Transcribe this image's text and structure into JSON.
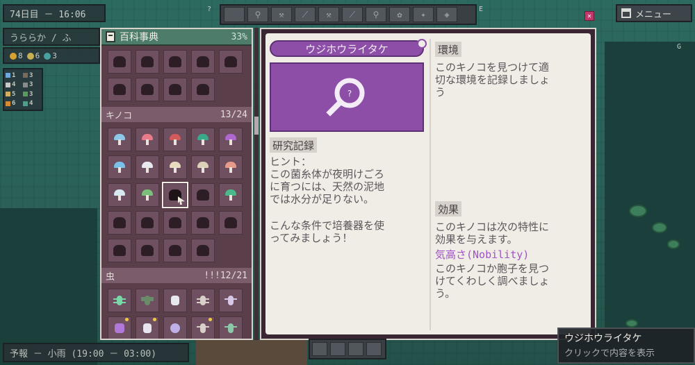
{
  "hud": {
    "day_time": "74日目 － 16:06",
    "weather": "うららか / ふ",
    "stats": [
      "8",
      "6",
      "3"
    ],
    "mini_stats": [
      "1",
      "3",
      "4",
      "3",
      "5",
      "3",
      "6",
      "4"
    ]
  },
  "toolbar": {
    "key_left": "?",
    "key_right": "E",
    "key_g": "G"
  },
  "menu": {
    "label": "メニュー"
  },
  "encyclopedia": {
    "title": "百科事典",
    "percent": "33%",
    "categories": [
      {
        "name": "キノコ",
        "count": "13/24"
      },
      {
        "name": "虫",
        "count": "!!!12/21"
      }
    ]
  },
  "detail": {
    "name": "ウジホウライタケ",
    "research_label": "研究記録",
    "hint_text": "ヒント：\nこの菌糸体が夜明けごろ\nに育つには、天然の泥地\nでは水分が足りない。",
    "incubator_text": "こんな条件で培養器を使\nってみましょう！",
    "env_label": "環境",
    "env_text": "このキノコを見つけて適\n切な環境を記録しましょ\nう",
    "effect_label": "効果",
    "effect_text": "このキノコは次の特性に\n効果を与えます。",
    "trait": "気高さ(Nobility)",
    "spore_text": "このキノコか胞子を見つ\nけてくわしく調べましょ\nう。"
  },
  "forecast": {
    "text": "予報 － 小雨 (19:00 － 03:00)"
  },
  "tooltip": {
    "name": "ウジホウライタケ",
    "hint": "クリックで内容を表示"
  },
  "colors": {
    "accent_purple": "#8d4ea8",
    "panel_bg": "#f0ece6",
    "ency_bg": "#5a3e4a",
    "header_green": "#4d7d6a"
  }
}
